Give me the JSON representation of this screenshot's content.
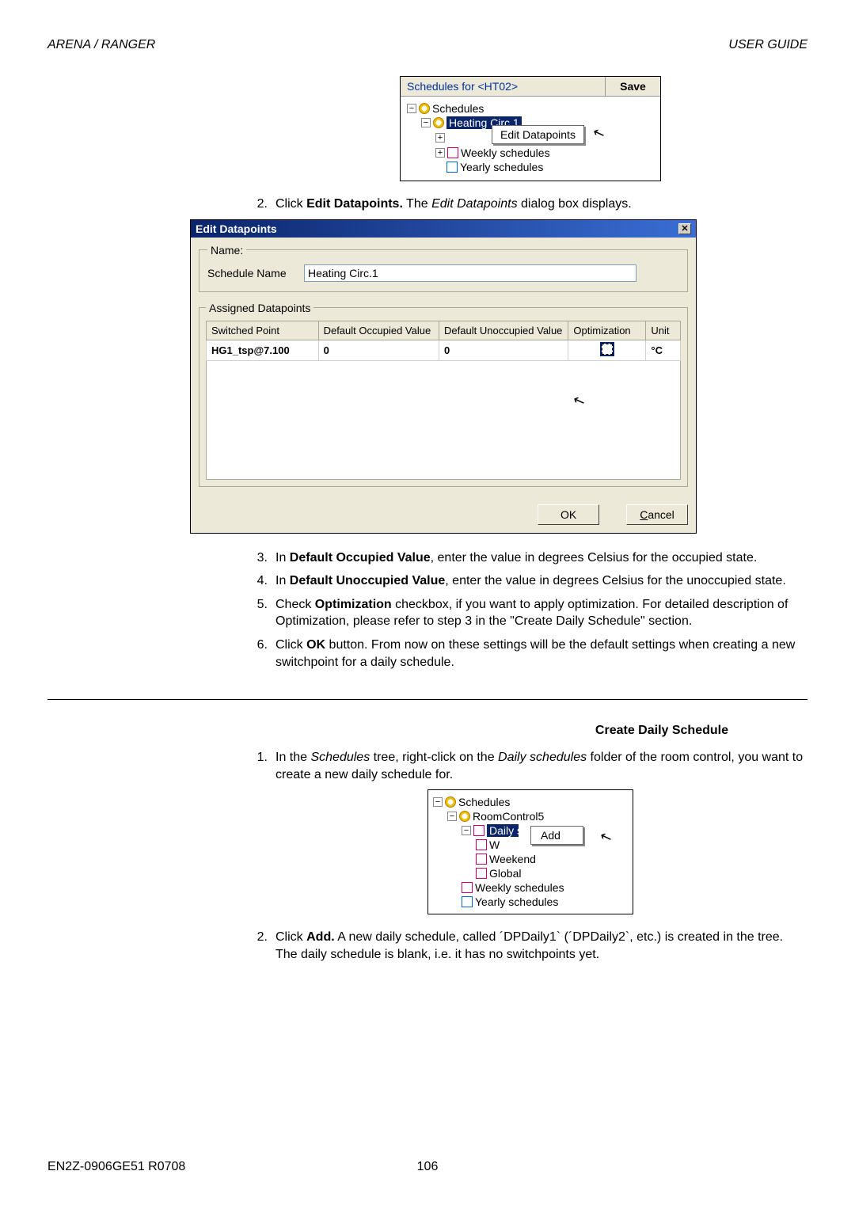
{
  "header": {
    "left": "ARENA / RANGER",
    "right": "USER GUIDE"
  },
  "footer": {
    "left": "EN2Z-0906GE51 R0708",
    "page": "106"
  },
  "fig1": {
    "title": "Schedules for  <HT02>",
    "save": "Save",
    "root": "Schedules",
    "selected": "Heating Circ.1",
    "menu": "Edit Datapoints",
    "weekly": "Weekly schedules",
    "yearly": "Yearly schedules"
  },
  "step2": {
    "num": "2.",
    "pre": "Click ",
    "b": "Edit Datapoints.",
    "mid": " The ",
    "i": "Edit Datapoints",
    "post": " dialog box displays."
  },
  "dlg": {
    "title": "Edit Datapoints",
    "grpName": "Name:",
    "lblScheduleName": "Schedule Name",
    "valScheduleName": "Heating Circ.1",
    "grpAssigned": "Assigned Datapoints",
    "cols": {
      "c1": "Switched Point",
      "c2": "Default Occupied Value",
      "c3": "Default Unoccupied Value",
      "c4": "Optimization",
      "c5": "Unit"
    },
    "row": {
      "c1": "HG1_tsp@7.100",
      "c2": "0",
      "c3": "0",
      "c5": "°C"
    },
    "ok": "OK",
    "cancel": "Cancel"
  },
  "step3": {
    "num": "3.",
    "pre": "In ",
    "b": "Default Occupied Value",
    "post": ", enter the value in degrees Celsius for the occupied state."
  },
  "step4": {
    "num": "4.",
    "pre": "In ",
    "b": "Default Unoccupied Value",
    "post": ", enter the value in degrees Celsius for the unoccupied state."
  },
  "step5": {
    "num": "5.",
    "pre": "Check ",
    "b": "Optimization",
    "post": " checkbox, if you want to apply optimization. For detailed description of Optimization, please refer to step 3 in the \"Create Daily Schedule\" section."
  },
  "step6": {
    "num": "6.",
    "pre": "Click ",
    "b": "OK",
    "post": " button. From now on these settings will be the default settings when creating a new switchpoint for a daily schedule."
  },
  "sectionTitle": "Create Daily Schedule",
  "cds1": {
    "num": "1.",
    "pre": "In the ",
    "i1": "Schedules",
    "mid1": " tree, right-click on the ",
    "i2": "Daily schedules",
    "post": " folder of the room control, you want to create a new daily schedule for."
  },
  "fig3": {
    "root": "Schedules",
    "rc": "RoomControl5",
    "daily": "Daily schedules",
    "menu": "Add",
    "w": "W",
    "weekend": "Weekend",
    "global": "Global",
    "weekly": "Weekly schedules",
    "yearly": "Yearly schedules"
  },
  "cds2": {
    "num": "2.",
    "pre": "Click ",
    "b": "Add.",
    "post": " A new daily schedule, called ´DPDaily1` (´DPDaily2`, etc.) is created in the tree. The daily schedule is blank, i.e. it has no switchpoints yet."
  }
}
